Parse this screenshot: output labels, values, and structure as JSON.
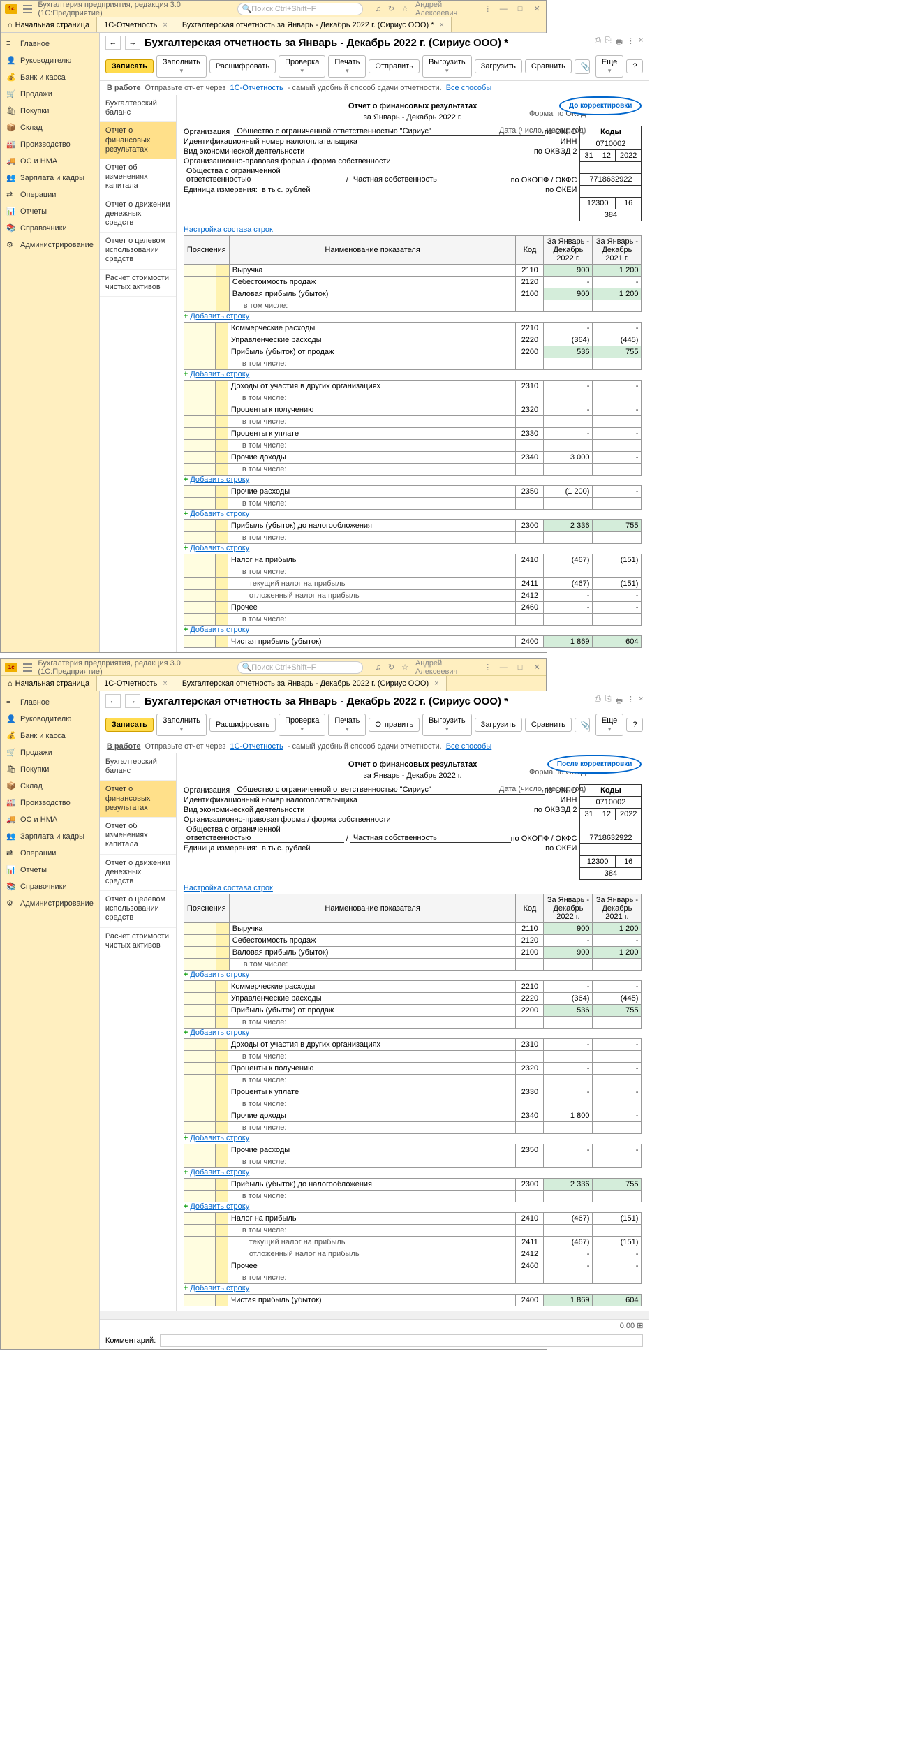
{
  "app": {
    "title": "Бухгалтерия предприятия, редакция 3.0  (1С:Предприятие)",
    "search": "Поиск Ctrl+Shift+F",
    "user": "Андрей Алексеевич"
  },
  "tabs": {
    "home": "Начальная страница",
    "t1": "1С-Отчетность",
    "t2": "Бухгалтерская отчетность за Январь - Декабрь 2022 г. (Сириус ООО) *",
    "t2b": "Бухгалтерская отчетность за Январь - Декабрь 2022 г. (Сириус ООО)"
  },
  "nav": [
    "Главное",
    "Руководителю",
    "Банк и касса",
    "Продажи",
    "Покупки",
    "Склад",
    "Производство",
    "ОС и НМА",
    "Зарплата и кадры",
    "Операции",
    "Отчеты",
    "Справочники",
    "Администрирование"
  ],
  "page": {
    "title": "Бухгалтерская отчетность за Январь - Декабрь 2022 г. (Сириус ООО) *"
  },
  "btns": {
    "save": "Записать",
    "fill": "Заполнить",
    "decode": "Расшифровать",
    "check": "Проверка",
    "print": "Печать",
    "send": "Отправить",
    "unload": "Выгрузить",
    "load": "Загрузить",
    "compare": "Сравнить",
    "more": "Еще"
  },
  "info": {
    "work": "В работе",
    "txt1": "Отправьте отчет через",
    "lnk1": "1С-Отчетность",
    "txt2": " - самый удобный способ сдачи отчетности.",
    "lnk2": "Все способы"
  },
  "side": [
    "Бухгалтерский баланс",
    "Отчет о финансовых результатах",
    "Отчет об изменениях капитала",
    "Отчет о движении денежных средств",
    "Отчет о целевом использовании средств",
    "Расчет стоимости чистых активов"
  ],
  "bubble1": "До корректировки",
  "bubble2": "После корректировки",
  "rep": {
    "title": "Отчет о финансовых результатах",
    "period": "за Январь - Декабрь 2022 г.",
    "codes": "Коды",
    "okud": "Форма по ОКУД",
    "okud_v": "0710002",
    "date": "Дата (число, месяц, год)",
    "d1": "31",
    "d2": "12",
    "d3": "2022",
    "org": "Организация",
    "org_v": "Общество с ограниченной ответственностью \"Сириус\"",
    "okpo": "по ОКПО",
    "inn": "Идентификационный номер налогоплательщика",
    "inn_l": "ИНН",
    "inn_v": "7718632922",
    "vid": "Вид экономической деятельности",
    "okved": "по ОКВЭД 2",
    "opf": "Организационно-правовая форма / форма собственности",
    "opf_v": "Общества с ограниченной ответственностью",
    "sep": "/",
    "priv": "Частная собственность",
    "okopf": "по ОКОПФ / ОКФС",
    "okopf1": "12300",
    "okopf2": "16",
    "unit": "Единица измерения:",
    "unit_v": "в тыс. рублей",
    "okei": "по ОКЕИ",
    "okei_v": "384",
    "tune": "Настройка состава строк",
    "add": "Добавить строку"
  },
  "th": {
    "expl": "Пояснения",
    "name": "Наименование показателя",
    "code": "Код",
    "c1": "За Январь - Декабрь 2022 г.",
    "c2": "За Январь - Декабрь 2021 г."
  },
  "rows1": [
    {
      "n": "Выручка",
      "c": "2110",
      "v1": "900",
      "v2": "1 200",
      "g": 1
    },
    {
      "n": "Себестоимость продаж",
      "c": "2120",
      "v1": "-",
      "v2": "-"
    },
    {
      "n": "Валовая прибыль (убыток)",
      "c": "2100",
      "v1": "900",
      "v2": "1 200",
      "g": 1
    },
    {
      "n": "в том числе:",
      "inc": 1
    }
  ],
  "rows2": [
    {
      "n": "Коммерческие расходы",
      "c": "2210",
      "v1": "-",
      "v2": "-"
    },
    {
      "n": "Управленческие расходы",
      "c": "2220",
      "v1": "(364)",
      "v2": "(445)"
    },
    {
      "n": "Прибыль (убыток) от продаж",
      "c": "2200",
      "v1": "536",
      "v2": "755",
      "g": 1
    },
    {
      "n": "в том числе:",
      "inc": 1
    }
  ],
  "rows3": [
    {
      "n": "Доходы от участия в других организациях",
      "c": "2310",
      "v1": "-",
      "v2": "-"
    },
    {
      "n": "в том числе:",
      "inc": 1
    },
    {
      "n": "Проценты к получению",
      "c": "2320",
      "v1": "-",
      "v2": "-"
    },
    {
      "n": "в том числе:",
      "inc": 1
    },
    {
      "n": "Проценты к уплате",
      "c": "2330",
      "v1": "-",
      "v2": "-"
    },
    {
      "n": "в том числе:",
      "inc": 1
    },
    {
      "n": "Прочие доходы",
      "c": "2340",
      "v1": "3 000",
      "v2": "-",
      "r": 1
    },
    {
      "n": "в том числе:",
      "inc": 1
    }
  ],
  "rows3b": [
    {
      "n": "Доходы от участия в других организациях",
      "c": "2310",
      "v1": "-",
      "v2": "-"
    },
    {
      "n": "в том числе:",
      "inc": 1
    },
    {
      "n": "Проценты к получению",
      "c": "2320",
      "v1": "-",
      "v2": "-"
    },
    {
      "n": "в том числе:",
      "inc": 1
    },
    {
      "n": "Проценты к уплате",
      "c": "2330",
      "v1": "-",
      "v2": "-"
    },
    {
      "n": "в том числе:",
      "inc": 1
    },
    {
      "n": "Прочие доходы",
      "c": "2340",
      "v1": "1 800",
      "v2": "-",
      "r": 1
    },
    {
      "n": "в том числе:",
      "inc": 1
    }
  ],
  "rows4": [
    {
      "n": "Прочие расходы",
      "c": "2350",
      "v1": "(1 200)",
      "v2": "-"
    },
    {
      "n": "в том числе:",
      "inc": 1
    }
  ],
  "rows4b": [
    {
      "n": "Прочие расходы",
      "c": "2350",
      "v1": "-",
      "v2": "-"
    },
    {
      "n": "в том числе:",
      "inc": 1
    }
  ],
  "rows5": [
    {
      "n": "Прибыль (убыток) до налогообложения",
      "c": "2300",
      "v1": "2 336",
      "v2": "755",
      "g": 1
    },
    {
      "n": "в том числе:",
      "inc": 1
    }
  ],
  "rows6": [
    {
      "n": "Налог на прибыль",
      "c": "2410",
      "v1": "(467)",
      "v2": "(151)"
    },
    {
      "n": "в том числе:",
      "inc": 1
    },
    {
      "n": "текущий налог на прибыль",
      "c": "2411",
      "v1": "(467)",
      "v2": "(151)",
      "inc2": 1
    },
    {
      "n": "отложенный налог на прибыль",
      "c": "2412",
      "v1": "-",
      "v2": "-",
      "inc2": 1
    },
    {
      "n": "Прочее",
      "c": "2460",
      "v1": "-",
      "v2": "-"
    },
    {
      "n": "в том числе:",
      "inc": 1
    }
  ],
  "rows7": [
    {
      "n": "Чистая прибыль (убыток)",
      "c": "2400",
      "v1": "1 869",
      "v2": "604",
      "g": 1
    }
  ],
  "foot": {
    "comment": "Комментарий:",
    "sum": "0,00"
  }
}
